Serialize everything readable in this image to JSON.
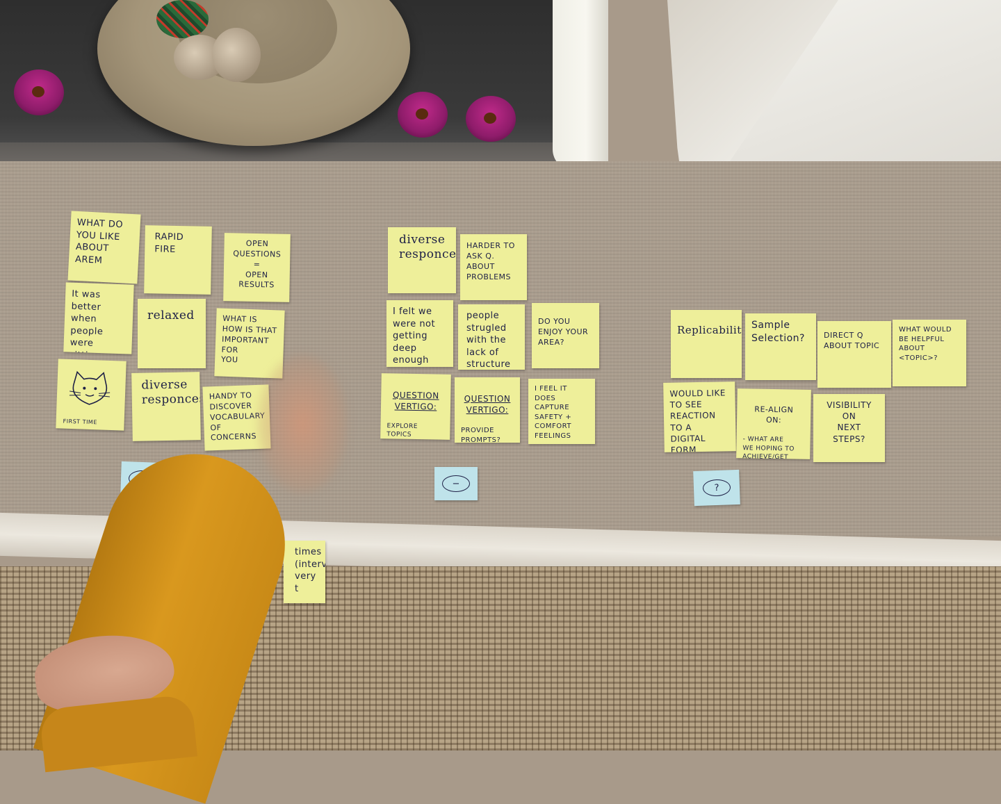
{
  "notes": {
    "n1": "What do\nyou like\nabout AREM",
    "n2": "RAPID\nFIRE",
    "n3": "OPEN\nQUESTIONS\n=\nOPEN\nRESULTS",
    "n4": "It was better\nwhen people\nwere sitting",
    "n5": "relaxed",
    "n6": "WHAT IS\nHOW IS THAT\nIMPORTANT FOR\nYOU",
    "n7_caption": "FIRST TIME",
    "n8": "diverse\nresponces",
    "n9": "HANDY TO\nDISCOVER\nVOCABULARY\nOF CONCERNS",
    "n10": "diverse\nresponces",
    "n11": "HARDER TO\nASK Q. ABOUT\nPROBLEMS",
    "n12": "I felt we\nwere not\ngetting deep\nenough",
    "n13": "people\nstrugled\nwith the\nlack of\nstructure",
    "n14": "DO YOU\nENJOY YOUR\nAREA?",
    "n15_title": "QUESTION\nVERTIGO:",
    "n15_body": "EXPLORE TOPICS\nMORE IN DEPTH?\nMORE SPECIFIC?",
    "n16_title": "QUESTION\nVERTIGO:",
    "n16_body": "PROVIDE\nPROMPTS?",
    "n17": "I FEEL IT\nDOES CAPTURE\nSAFETY +\nCOMFORT\nFEELINGS",
    "n18": "Replicability",
    "n19": "Sample\nSelection?",
    "n20": "DIRECT Q\nABOUT TOPIC",
    "n21": "WHAT WOULD\nBE HELPFUL\nABOUT <TOPIC>?",
    "n22": "WOULD LIKE\nTO SEE\nREACTION\nTO A DIGITAL\nFORM",
    "n23_title": "RE-ALIGN\nON:",
    "n23_body": "- WHAT ARE\nWE HOPING TO\nACHIEVE/GET\nOUT OF THESE?",
    "n24": "VISIBILITY\nON\nNEXT\nSTEPS?",
    "n25": "times\n(intervie\nvery\nt"
  },
  "column_labels": {
    "plus": "+",
    "minus": "−",
    "question": "?"
  },
  "colors": {
    "sticky_yellow": "#eeef9a",
    "label_blue": "#bfe3ea",
    "ink": "#1e2046"
  }
}
